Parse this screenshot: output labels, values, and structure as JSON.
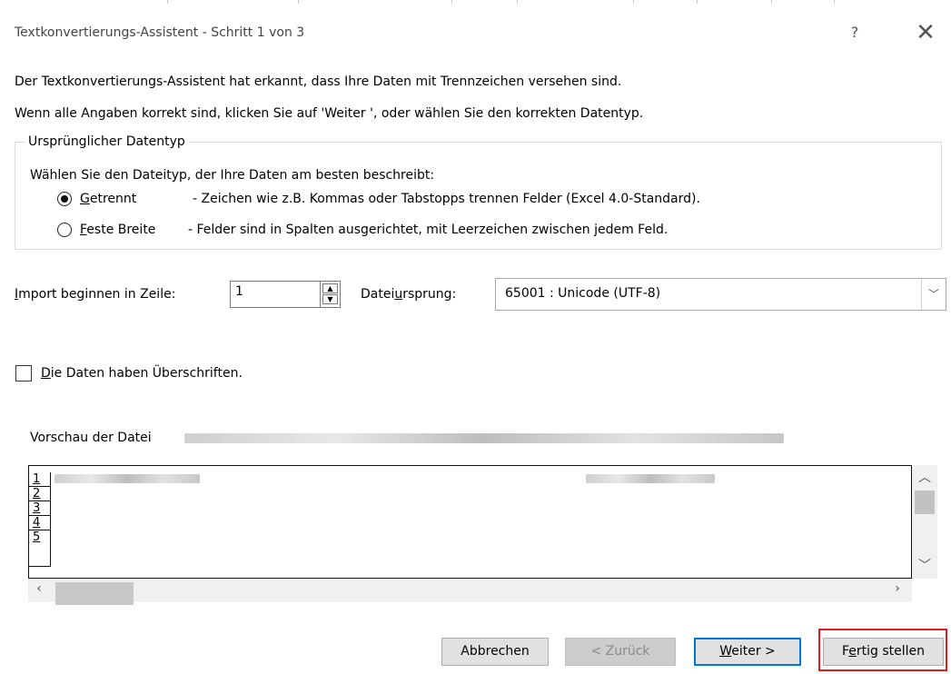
{
  "dialog": {
    "title": "Textkonvertierungs-Assistent - Schritt 1 von 3",
    "help_glyph": "?",
    "close_glyph": "✕"
  },
  "intro": {
    "line1": "Der Textkonvertierungs-Assistent hat erkannt, dass Ihre Daten mit Trennzeichen versehen sind.",
    "line2": "Wenn alle Angaben korrekt sind, klicken Sie auf 'Weiter ', oder wählen Sie den korrekten Datentyp."
  },
  "datatype_group": {
    "legend": "Ursprünglicher Datentyp",
    "prompt": "Wählen Sie den Dateityp, der Ihre Daten am besten beschreibt:",
    "options": [
      {
        "mnemonic": "G",
        "label_rest": "etrennt",
        "description": "- Zeichen wie z.B. Kommas oder Tabstopps trennen Felder (Excel 4.0-Standard).",
        "selected": true
      },
      {
        "mnemonic": "F",
        "label_rest": "este Breite",
        "description": "- Felder sind in Spalten ausgerichtet, mit Leerzeichen zwischen jedem Feld.",
        "selected": false
      }
    ]
  },
  "import_row": {
    "mnemonic": "I",
    "label_rest": "mport beginnen in Zeile:",
    "value": "1"
  },
  "origin": {
    "label_pre": "Datei",
    "mnemonic": "u",
    "label_post": "rsprung:",
    "value": "65001 : Unicode (UTF-8)"
  },
  "headers_checkbox": {
    "mnemonic": "D",
    "label_rest": "ie Daten haben Überschriften.",
    "checked": false
  },
  "preview": {
    "label": "Vorschau der Datei",
    "row_numbers": [
      "1",
      "2",
      "3",
      "4",
      "5"
    ]
  },
  "buttons": {
    "cancel": "Abbrechen",
    "back": "< Zurück",
    "next_mnemonic": "W",
    "next_rest": "eiter >",
    "finish_pre": "F",
    "finish_mnemonic": "e",
    "finish_post": "rtig stellen"
  },
  "colors": {
    "default_button_border": "#0078d7",
    "highlight": "#e11d1d"
  },
  "icons": [
    "help-icon",
    "close-icon",
    "spin-up-icon",
    "spin-down-icon",
    "chevron-down-icon",
    "scroll-up-icon",
    "scroll-down-icon",
    "scroll-left-icon",
    "scroll-right-icon"
  ]
}
